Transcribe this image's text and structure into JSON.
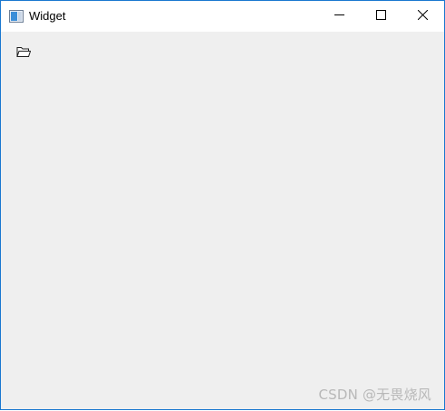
{
  "window": {
    "title": "Widget",
    "icon": "app-window-icon"
  },
  "titlebar_buttons": {
    "minimize_icon": "minimize-icon",
    "maximize_icon": "maximize-icon",
    "close_icon": "close-icon"
  },
  "toolbar": {
    "open_icon": "folder-open-icon"
  },
  "watermark": {
    "text": "CSDN @无畏烧风"
  },
  "colors": {
    "window_border": "#1a78d0",
    "content_bg": "#efefef",
    "titlebar_bg": "#ffffff",
    "watermark": "#b8b8b8"
  }
}
